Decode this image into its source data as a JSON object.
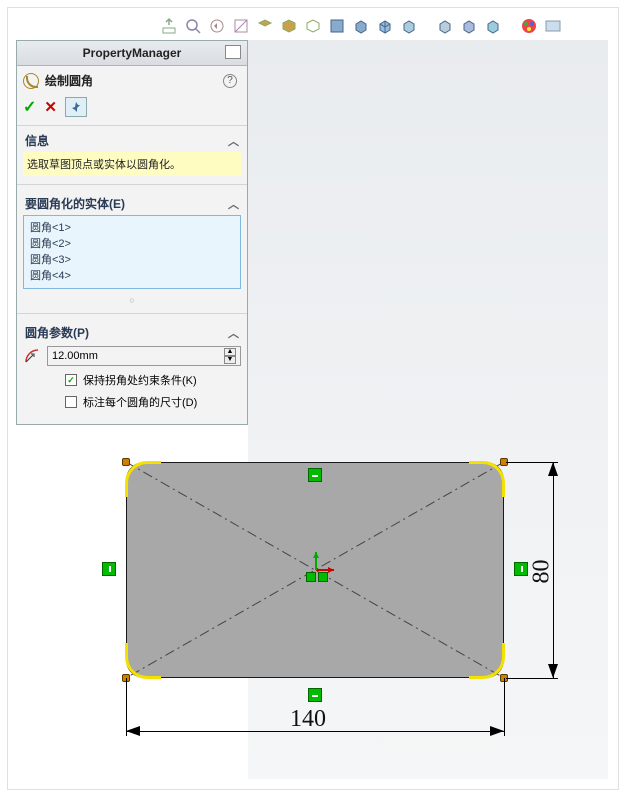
{
  "pm": {
    "title": "PropertyManager"
  },
  "feature": {
    "title": "绘制圆角",
    "help_tip": "?"
  },
  "actions": {
    "ok": "✓",
    "cancel": "✕"
  },
  "info": {
    "header": "信息",
    "body": "选取草图顶点或实体以圆角化。"
  },
  "entities": {
    "header": "要圆角化的实体(E)",
    "items": [
      "圆角<1>",
      "圆角<2>",
      "圆角<3>",
      "圆角<4>"
    ]
  },
  "params": {
    "header": "圆角参数(P)",
    "radius": "12.00mm",
    "keep_constraints": {
      "label": "保持拐角处约束条件(K)",
      "checked": true
    },
    "dim_each": {
      "label": "标注每个圆角的尺寸(D)",
      "checked": false
    }
  },
  "sketch": {
    "width_dim": "140",
    "height_dim": "80"
  },
  "chevron": "︿"
}
